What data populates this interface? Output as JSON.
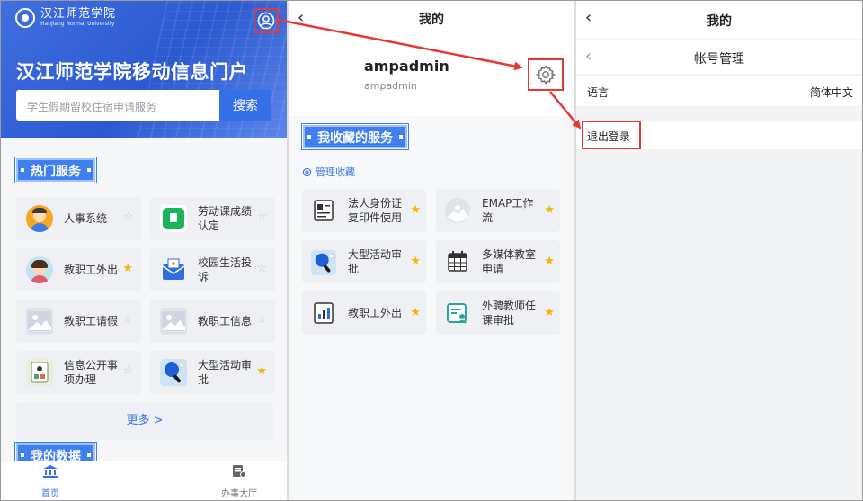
{
  "panel1": {
    "logo": {
      "cn": "汉江师范学院",
      "en": "Hanjiang Normal University"
    },
    "hero_title": "汉江师范学院移动信息门户",
    "search": {
      "placeholder": "学生假期留校住宿申请服务",
      "button": "搜索"
    },
    "hot_title": "热门服务",
    "services": [
      {
        "label": "人事系统",
        "icon": "person-avatar-icon",
        "starred": false
      },
      {
        "label": "劳动课成绩认定",
        "icon": "book-green-icon",
        "starred": false
      },
      {
        "label": "教职工外出",
        "icon": "person-woman-icon",
        "starred": true
      },
      {
        "label": "校园生活投诉",
        "icon": "envelope-icon",
        "starred": false
      },
      {
        "label": "教职工请假",
        "icon": "image-placeholder-icon",
        "starred": false
      },
      {
        "label": "教职工信息",
        "icon": "image-placeholder-icon",
        "starred": false
      },
      {
        "label": "信息公开事项办理",
        "icon": "document-box-icon",
        "starred": false
      },
      {
        "label": "大型活动审批",
        "icon": "pingpong-icon",
        "starred": true
      }
    ],
    "more": "更多 >",
    "data_title": "我的数据",
    "tabs": [
      {
        "label": "首页",
        "icon": "bank-icon"
      },
      {
        "label": "办事大厅",
        "icon": "hall-icon"
      }
    ]
  },
  "panel2": {
    "title": "我的",
    "username": "ampadmin",
    "userid": "ampadmin",
    "fav_title": "我收藏的服务",
    "manage": "管理收藏",
    "favorites": [
      {
        "label": "法人身份证复印件使用",
        "icon": "id-card-icon"
      },
      {
        "label": "EMAP工作流",
        "icon": "image-placeholder-icon"
      },
      {
        "label": "大型活动审批",
        "icon": "pingpong-icon"
      },
      {
        "label": "多媒体教室申请",
        "icon": "calendar-icon"
      },
      {
        "label": "教职工外出",
        "icon": "chart-doc-icon"
      },
      {
        "label": "外聘教师任课审批",
        "icon": "teacher-card-icon"
      }
    ]
  },
  "panel3": {
    "title": "我的",
    "sub_title": "帐号管理",
    "language_label": "语言",
    "language_value": "简体中文",
    "logout": "退出登录"
  },
  "colors": {
    "brand_blue": "#3570e8",
    "highlight_red": "#e53935",
    "star_yellow": "#f5b400"
  }
}
